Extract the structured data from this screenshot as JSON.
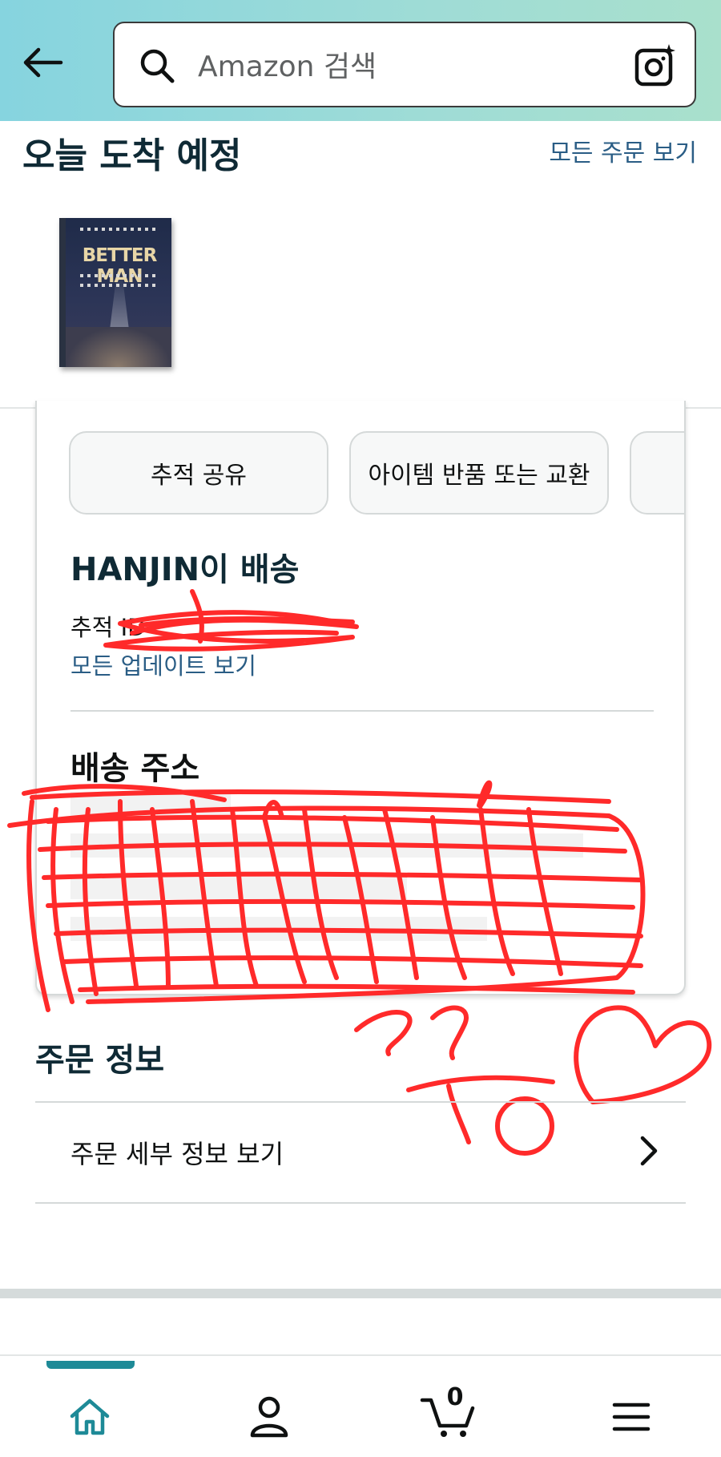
{
  "search": {
    "placeholder": "Amazon 검색"
  },
  "arrival": {
    "title": "오늘 도착 예정",
    "view_all_link": "모든 주문 보기",
    "product_title": "BETTER MAN"
  },
  "actions": {
    "share_tracking": "추적 공유",
    "return_or_exchange": "아이템 반품 또는 교환"
  },
  "shipment": {
    "carrier_title": "HANJIN이 배송",
    "tracking_label": "추적 ID",
    "view_updates_link": "모든 업데이트 보기"
  },
  "address": {
    "title": "배송 주소"
  },
  "order_info": {
    "title": "주문 정보",
    "view_details": "주문 세부 정보 보기"
  },
  "bottom_nav": {
    "cart_count": "0",
    "items": [
      "home-icon",
      "profile-icon",
      "cart-icon",
      "menu-icon"
    ],
    "active_color": "#1e8a97"
  },
  "colors": {
    "header_gradient_start": "#86d4df",
    "header_gradient_end": "#a9e0cc",
    "link": "#2a5d85",
    "redaction": "#ff2a2a"
  }
}
